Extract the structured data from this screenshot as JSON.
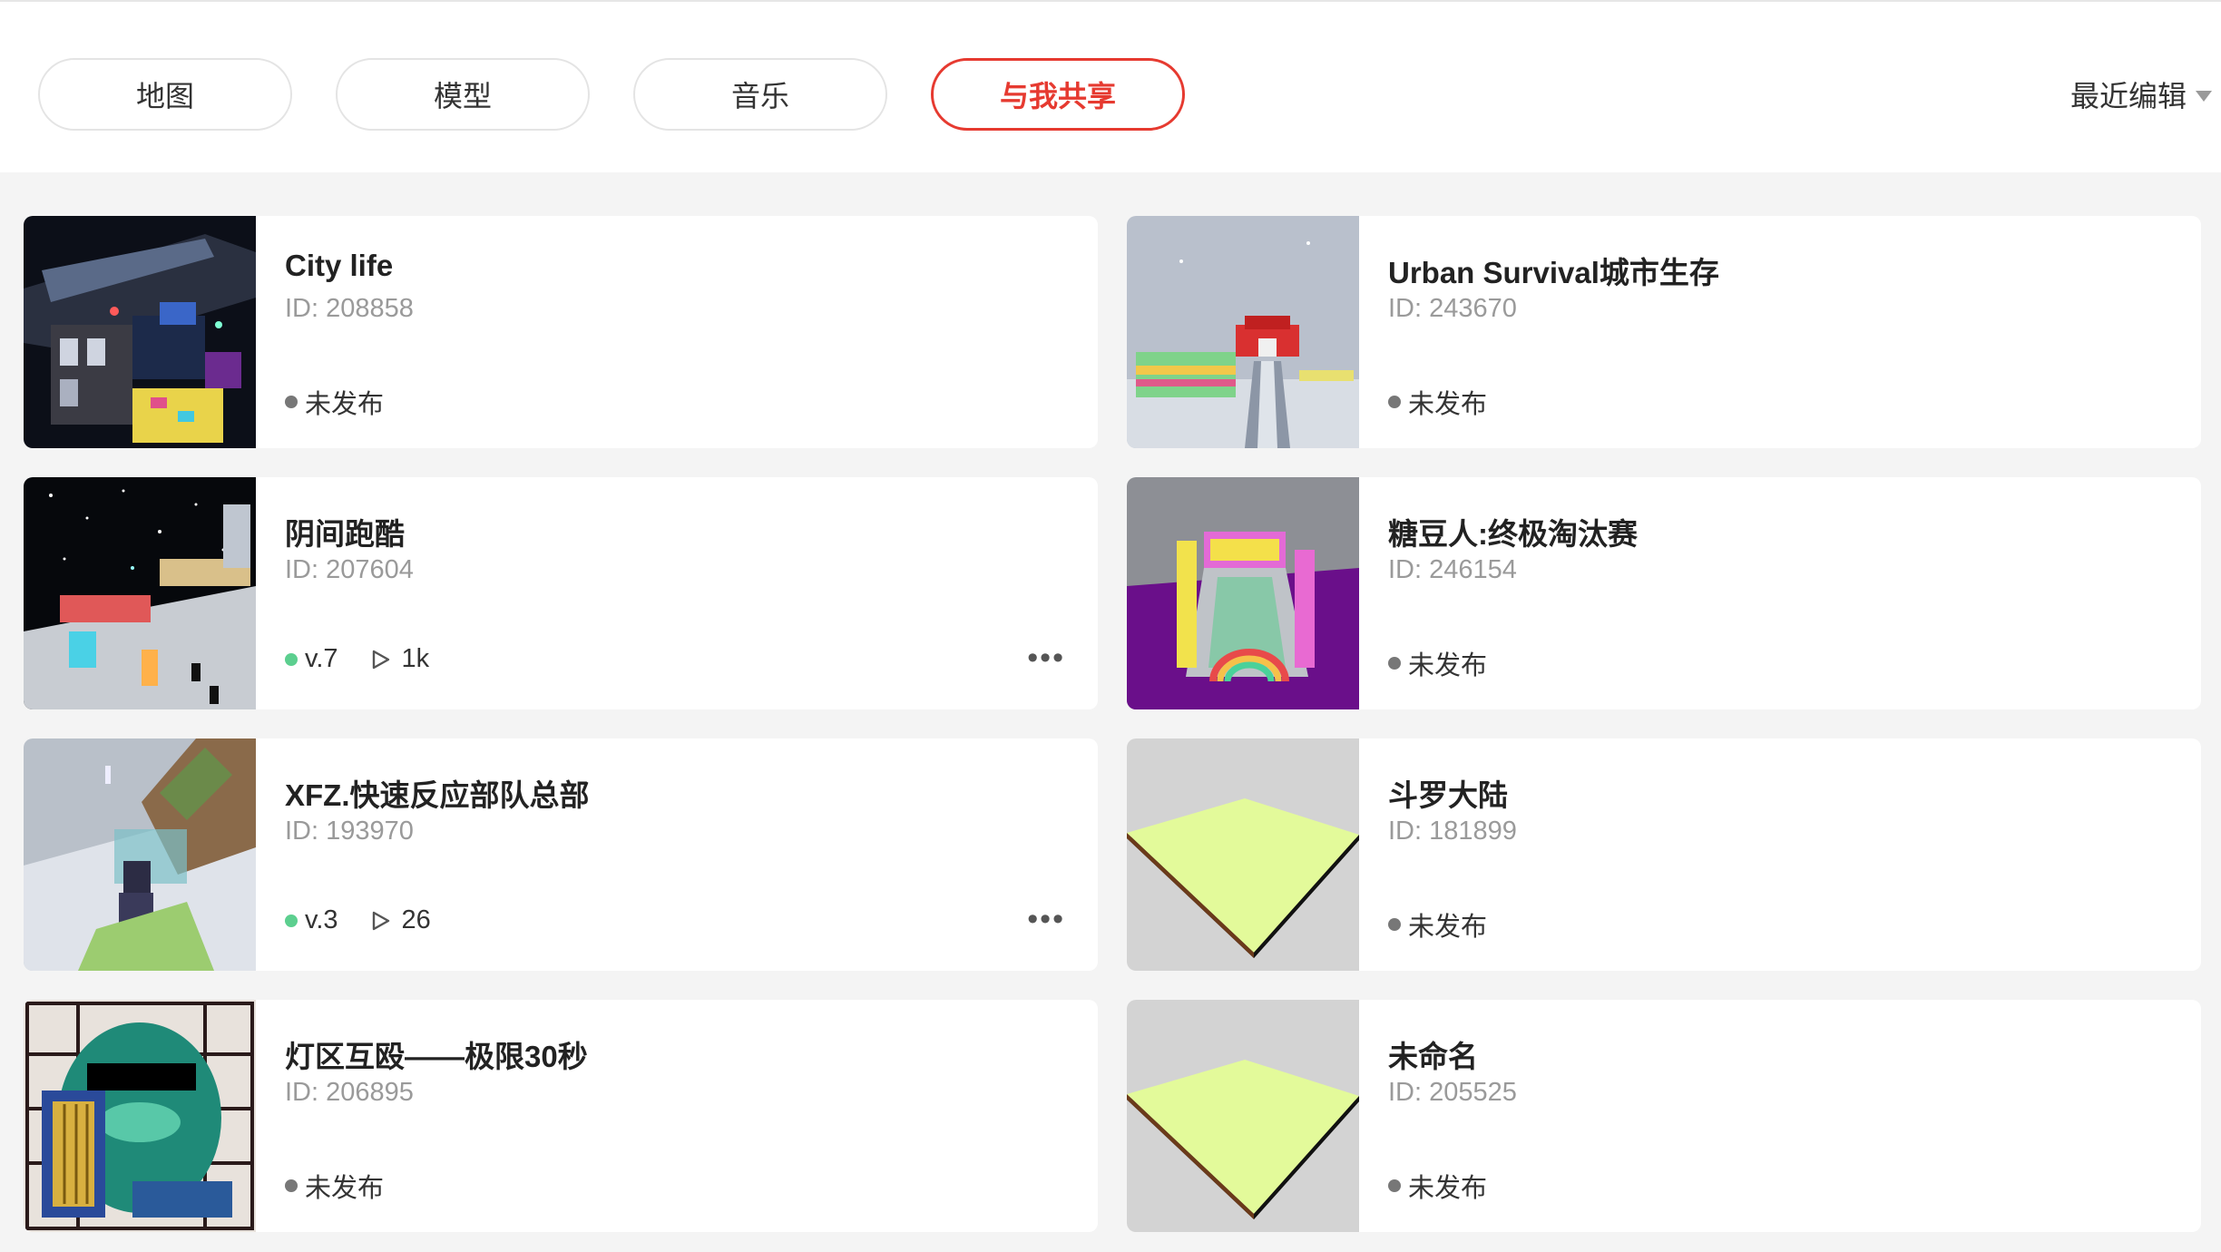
{
  "tabs": [
    {
      "label": "地图"
    },
    {
      "label": "模型"
    },
    {
      "label": "音乐"
    },
    {
      "label": "与我共享",
      "active": true
    }
  ],
  "sort": {
    "label": "最近编辑"
  },
  "cards": [
    {
      "title": "City life",
      "id": "ID: 208858",
      "status": "未发布",
      "thumb": "city-night"
    },
    {
      "title": "Urban Survival城市生存",
      "id": "ID: 243670",
      "status": "未发布",
      "thumb": "urban-gate"
    },
    {
      "title": "阴间跑酷",
      "id": "ID: 207604",
      "version": "v.7",
      "plays": "1k",
      "thumb": "starry-parkour"
    },
    {
      "title": "糖豆人:终极淘汰赛",
      "id": "ID: 246154",
      "status": "未发布",
      "thumb": "purple-arena"
    },
    {
      "title": "XFZ.快速反应部队总部",
      "id": "ID: 193970",
      "version": "v.3",
      "plays": "26",
      "thumb": "mountain-base"
    },
    {
      "title": "斗罗大陆",
      "id": "ID: 181899",
      "status": "未发布",
      "thumb": "flat-plate"
    },
    {
      "title": "灯区互殴——极限30秒",
      "id": "ID: 206895",
      "status": "未发布",
      "thumb": "panda"
    },
    {
      "title": "未命名",
      "id": "ID: 205525",
      "status": "未发布",
      "thumb": "flat-plate"
    }
  ],
  "colors": {
    "accent": "#e63a30",
    "published_dot": "#5ccf8f",
    "unpublished_dot": "#777777"
  }
}
